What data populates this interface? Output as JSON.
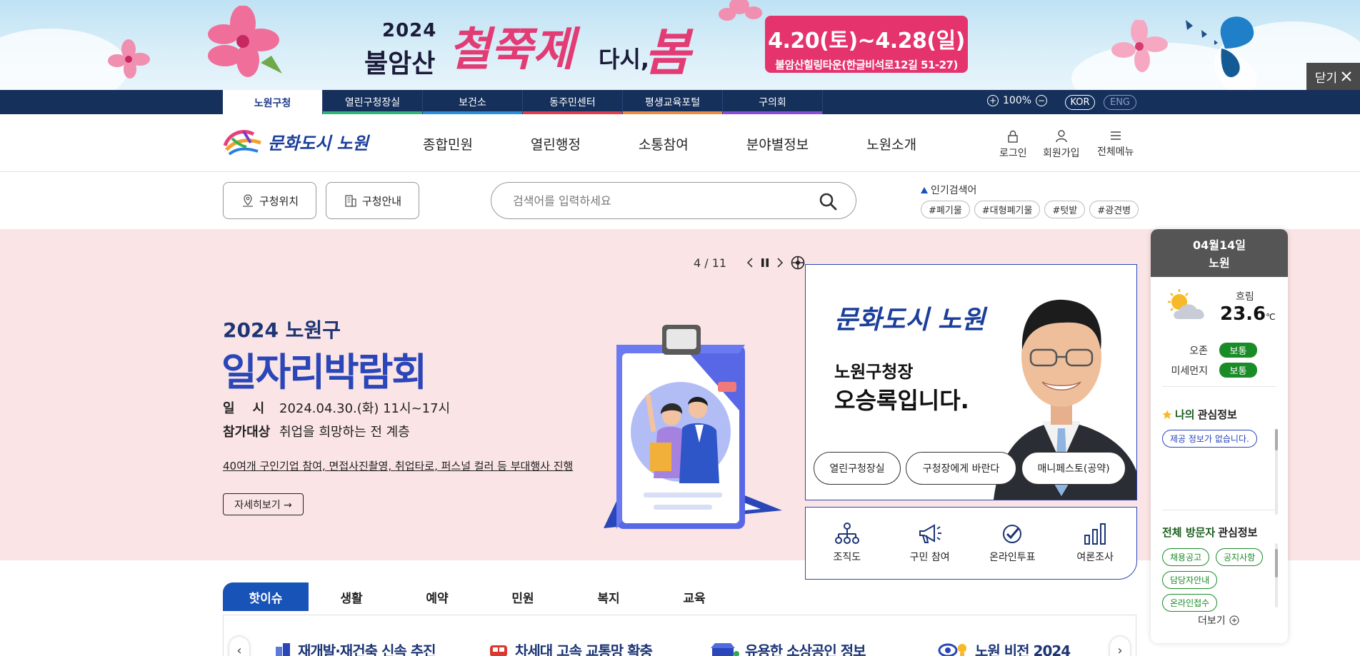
{
  "banner": {
    "year": "2024",
    "place": "불암산",
    "festival": "철쭉제",
    "again": "다시,",
    "spring": "봄",
    "date": "4.20(토)~4.28(일)",
    "venue": "불암산힐링타운(한글비석로12길 51-27)",
    "close_label": "닫기"
  },
  "site_tabs": [
    {
      "label": "노원구청",
      "color": "#ffffff"
    },
    {
      "label": "열린구청장실",
      "color": "#2fb57a"
    },
    {
      "label": "보건소",
      "color": "#2a8fd8"
    },
    {
      "label": "동주민센터",
      "color": "#e03c4a"
    },
    {
      "label": "평생교육포털",
      "color": "#f08a3c"
    },
    {
      "label": "구의회",
      "color": "#8a4cd8"
    }
  ],
  "zoom": {
    "value": "100%"
  },
  "lang": {
    "kor": "KOR",
    "eng": "ENG"
  },
  "logo": {
    "text": "문화도시 노원"
  },
  "gnb": [
    "종합민원",
    "열린행정",
    "소통참여",
    "분야별정보",
    "노원소개"
  ],
  "util": {
    "login": "로그인",
    "join": "회원가입",
    "menu": "전체메뉴"
  },
  "quick": {
    "location": "구청위치",
    "guide": "구청안내"
  },
  "search": {
    "placeholder": "검색어를 입력하세요"
  },
  "popular": {
    "title": "인기검색어",
    "tags": [
      "#폐기물",
      "#대형폐기물",
      "#텃밭",
      "#광견병"
    ]
  },
  "hero": {
    "subtitle": "2024 노원구",
    "title": "일자리박람회",
    "date_key": "일    시",
    "date_val": "2024.04.30.(화) 11시~17시",
    "target_key": "참가대상",
    "target_val": "취업을 희망하는 전 계층",
    "desc": "40여개 구인기업 참여, 면접사진촬영, 취업타로, 퍼스널 컬러 등 부대행사 진행",
    "more": "자세히보기 →",
    "pager": "4 / 11"
  },
  "mayor": {
    "logo": "문화도시 노원",
    "line1": "노원구청장",
    "line2": "오승록입니다.",
    "buttons": [
      "열린구청장실",
      "구청장에게 바란다",
      "매니페스토(공약)"
    ]
  },
  "icon_links": [
    "조직도",
    "구민 참여",
    "온라인투표",
    "여론조사"
  ],
  "side": {
    "date": "04월14일",
    "location": "노원",
    "weather": "흐림",
    "temp": "23.6",
    "unit": "℃",
    "ozone_label": "오존",
    "ozone_val": "보통",
    "dust_label": "미세먼지",
    "dust_val": "보통",
    "my_title_hl": "나의",
    "my_title": "관심정보",
    "my_empty": "제공 정보가 없습니다.",
    "all_title_hl": "전체 방문자",
    "all_title": "관심정보",
    "all_chips": [
      "채용공고",
      "공지사항",
      "담당자안내",
      "온라인접수"
    ],
    "more": "더보기"
  },
  "issue_tabs": [
    "핫이슈",
    "생활",
    "예약",
    "민원",
    "복지",
    "교육"
  ],
  "issue_items": [
    "재개발·재건축 신속 추진",
    "차세대 고속 교통망 확충",
    "유용한 소상공인 정보",
    "노원 비전 2024"
  ]
}
